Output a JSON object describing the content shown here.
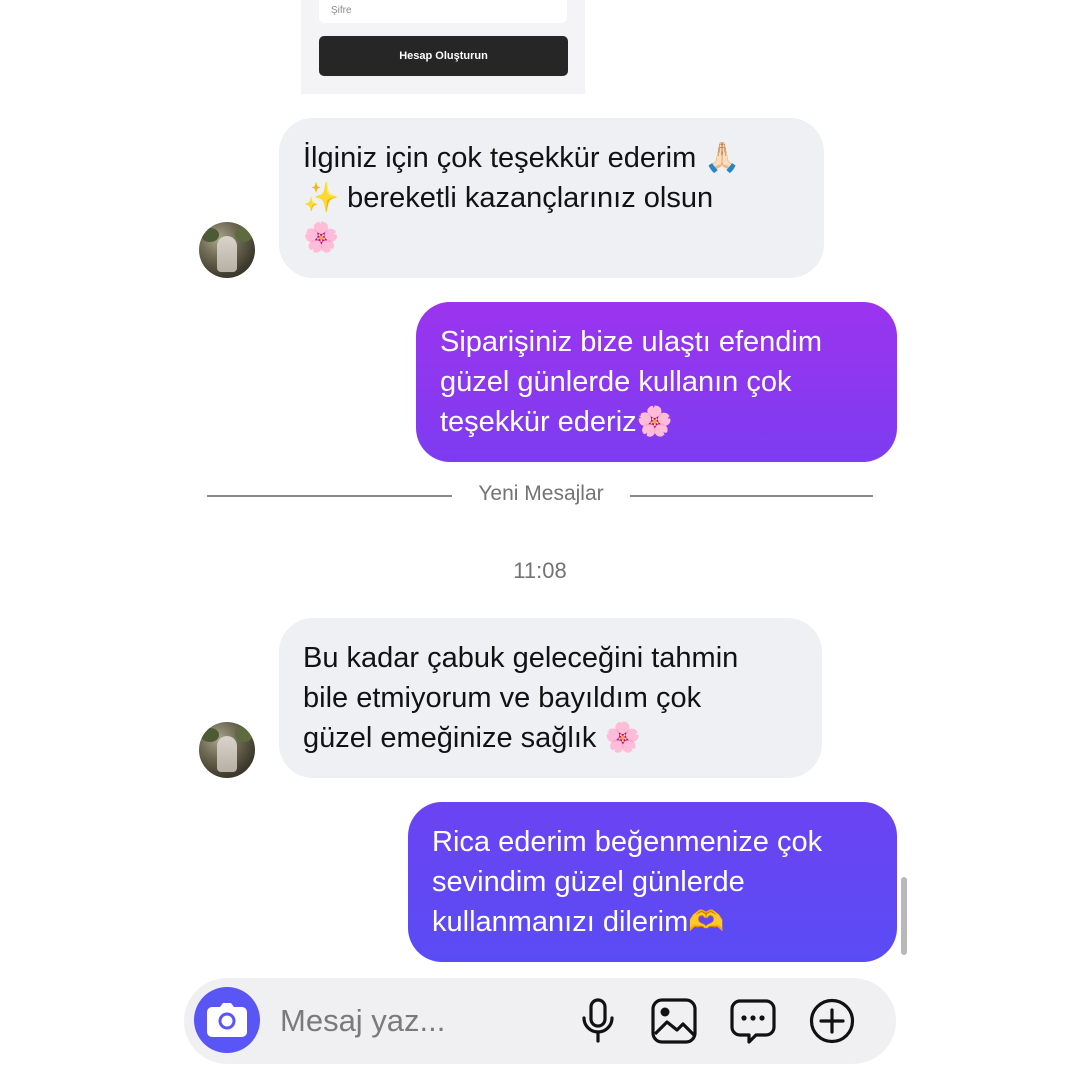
{
  "shared_card": {
    "password_placeholder": "Şifre",
    "create_account_label": "Hesap Oluşturun"
  },
  "messages": [
    {
      "direction": "incoming",
      "text": "İlginiz için çok teşekkür ederim 🙏🏻\n✨ bereketli kazançlarınız olsun\n🌸"
    },
    {
      "direction": "outgoing",
      "text": "Siparişiniz bize ulaştı efendim\ngüzel günlerde kullanın çok\nteşekkür ederiz🌸"
    },
    {
      "direction": "incoming",
      "text": "Bu kadar çabuk geleceğini tahmin\nbile etmiyorum ve bayıldım çok\ngüzel emeğinize sağlık 🌸"
    },
    {
      "direction": "outgoing",
      "text": "Rica ederim beğenmenize çok\nsevindim güzel günlerde\nkullanmanızı dilerim🫶"
    }
  ],
  "divider_label": "Yeni Mesajlar",
  "timestamp": "11:08",
  "composer": {
    "placeholder": "Mesaj yaz...",
    "icons": [
      "camera-icon",
      "microphone-icon",
      "gallery-icon",
      "sticker-icon",
      "add-icon"
    ]
  },
  "colors": {
    "outgoing_bubble_1": "#8a38f0",
    "outgoing_bubble_2": "#6247f3",
    "incoming_bubble": "#eff0f3",
    "camera_button": "#5a55f5"
  }
}
